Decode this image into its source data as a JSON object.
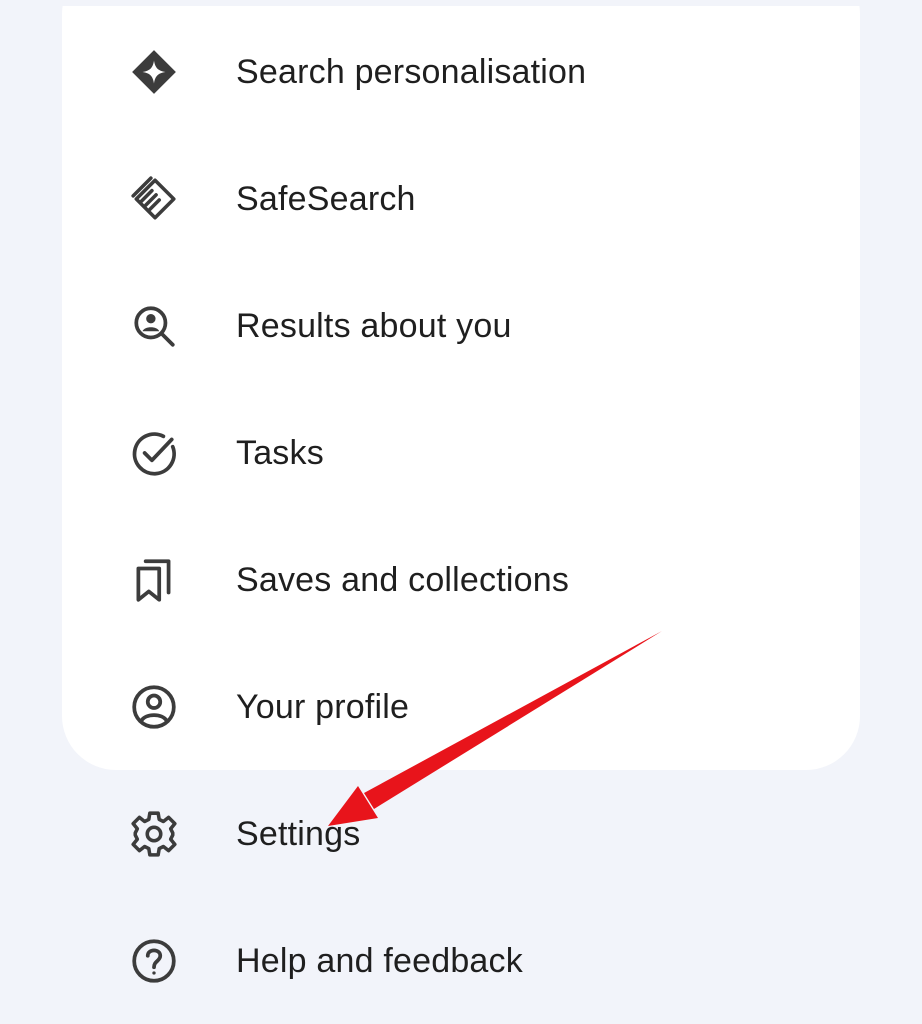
{
  "menu": {
    "items": [
      {
        "label": "Search personalisation",
        "icon": "sparkle-diamond-icon"
      },
      {
        "label": "SafeSearch",
        "icon": "safesearch-hand-icon"
      },
      {
        "label": "Results about you",
        "icon": "search-person-icon"
      },
      {
        "label": "Tasks",
        "icon": "check-circle-icon"
      },
      {
        "label": "Saves and collections",
        "icon": "bookmarks-icon"
      },
      {
        "label": "Your profile",
        "icon": "account-circle-icon"
      },
      {
        "label": "Settings",
        "icon": "gear-icon"
      },
      {
        "label": "Help and feedback",
        "icon": "help-circle-icon"
      }
    ]
  },
  "colors": {
    "background": "#f2f4fa",
    "card": "#ffffff",
    "text": "#1f1f1f",
    "icon": "#3c3c3c",
    "annotation_arrow": "#e8141b"
  }
}
